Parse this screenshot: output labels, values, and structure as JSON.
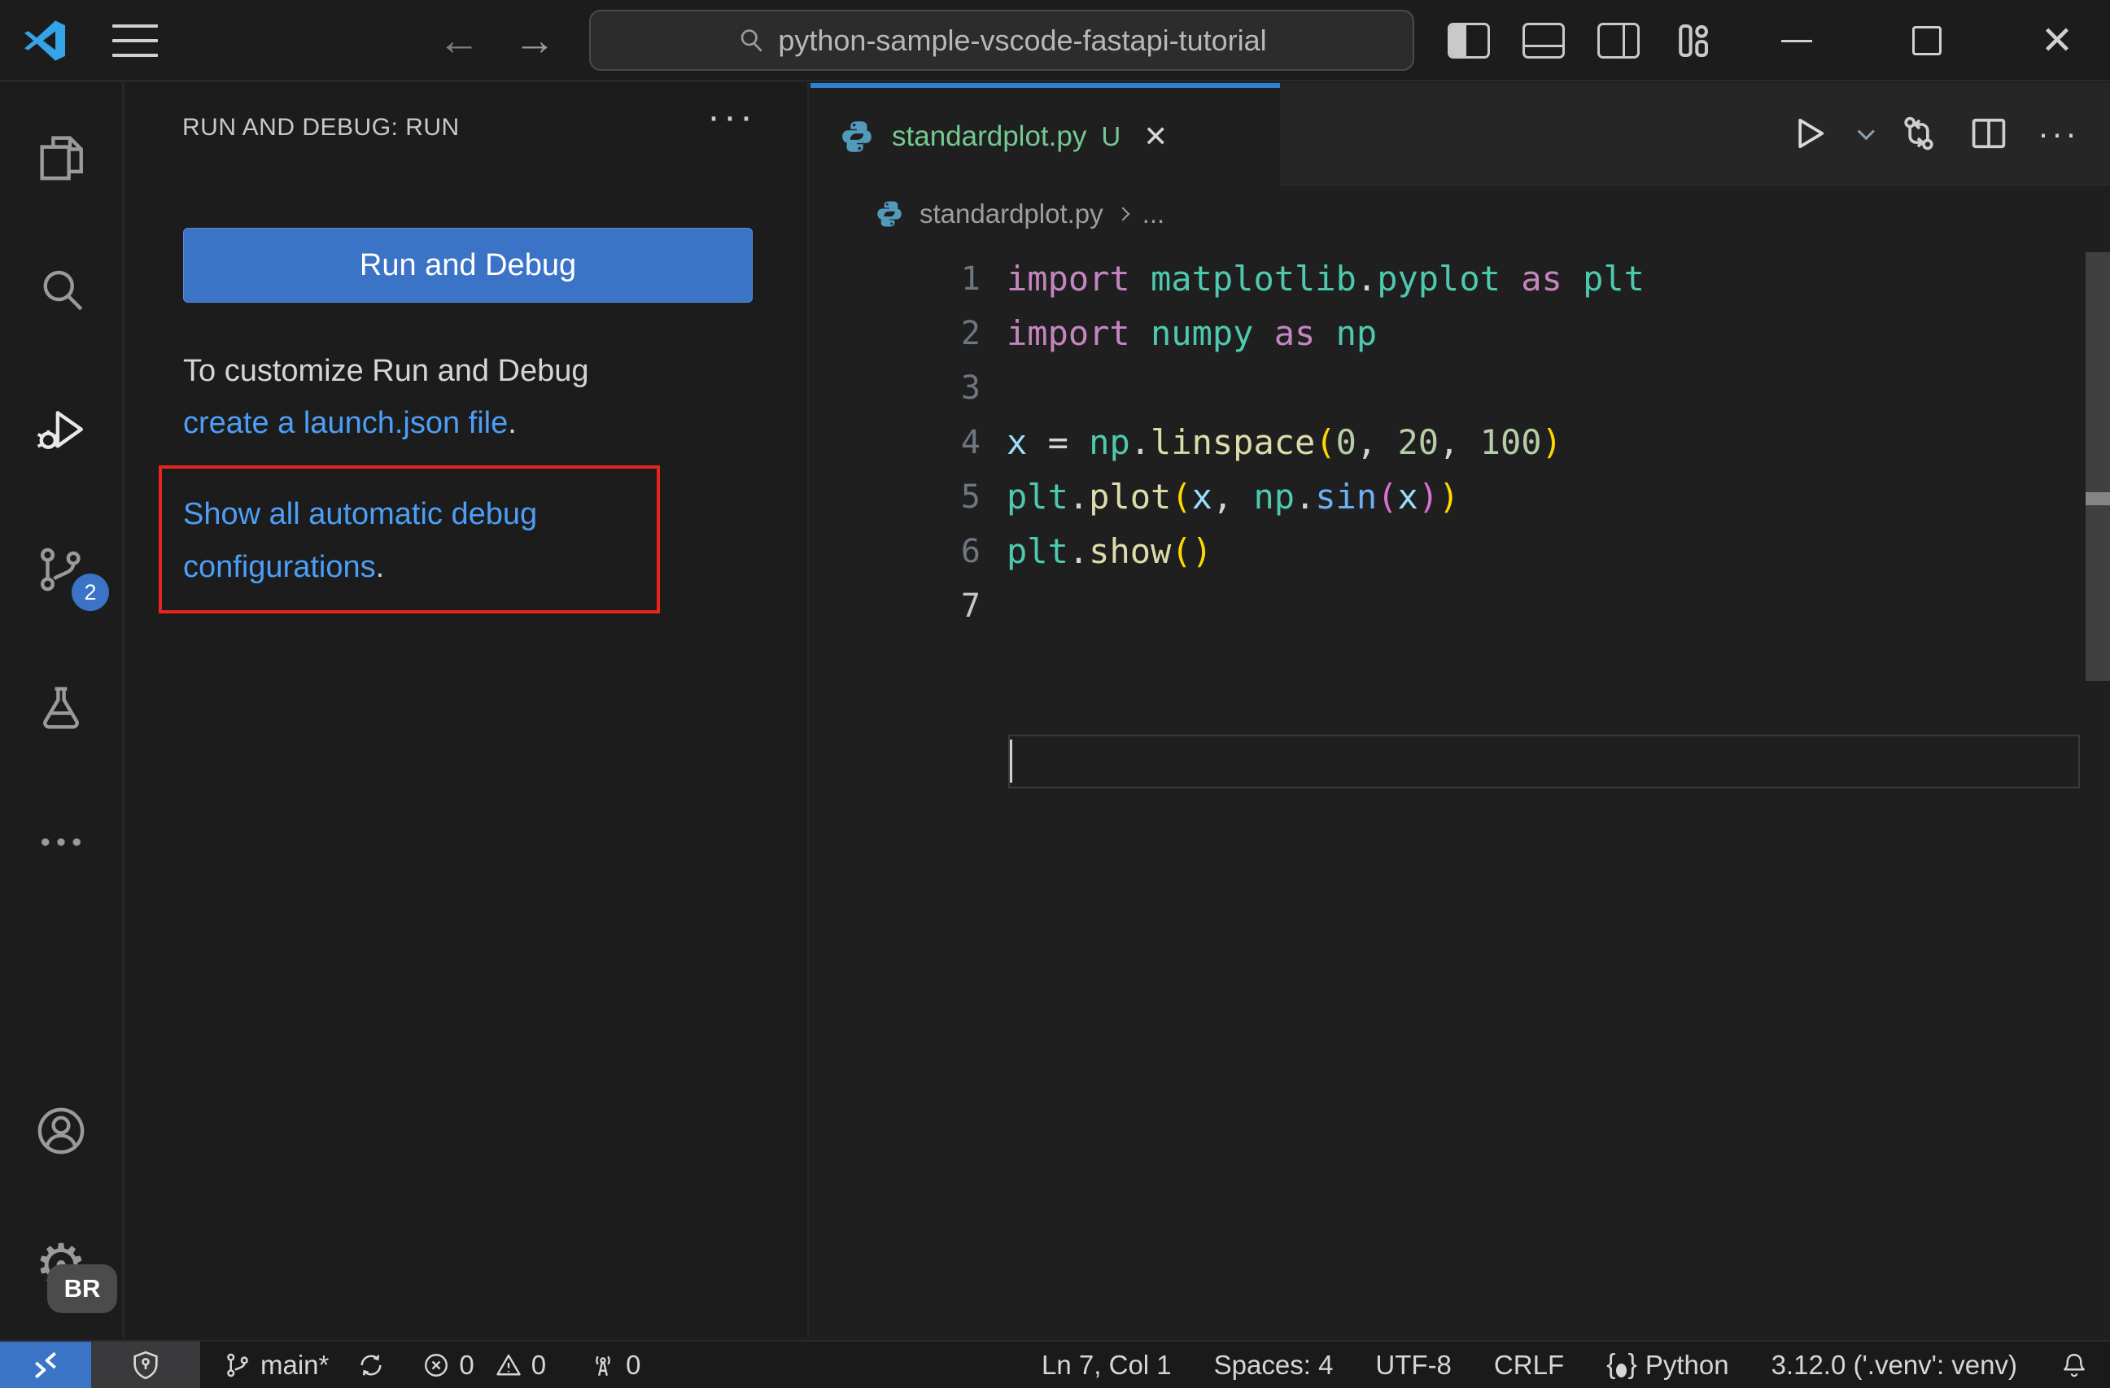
{
  "titlebar": {
    "search_value": "python-sample-vscode-fastapi-tutorial"
  },
  "colors": {
    "accent_blue": "#3b73c6",
    "link_blue": "#4d9ef7",
    "annotation_red": "#e6261c",
    "file_green": "#73c991",
    "tab_border_blue": "#2f81d7",
    "tok_kw": "#c586c0",
    "tok_mod": "#4ec9b0",
    "tok_fn": "#dcdcaa",
    "tok_fnb": "#6cb0f3",
    "tok_var": "#9cdcfe",
    "tok_num": "#b5cea8",
    "tok_op": "#d4d4d4",
    "tok_b1": "#ffd700",
    "tok_b2": "#da70d6"
  },
  "activity_bar": {
    "scm_badge": "2",
    "profile_badge": "BR"
  },
  "sidebar": {
    "header": "RUN AND DEBUG: RUN",
    "menu_dots": "···",
    "run_button": "Run and Debug",
    "intro_line": "To customize Run and Debug",
    "launch_link": "create a launch.json file",
    "launch_suffix": ".",
    "auto_debug_link": "Show all automatic debug configurations",
    "auto_debug_suffix": "."
  },
  "editor": {
    "tab": {
      "label": "standardplot.py",
      "dirty": "U",
      "close": "✕"
    },
    "actions_dots": "···",
    "breadcrumb": {
      "file": "standardplot.py",
      "more": "..."
    },
    "code": {
      "lines": [
        {
          "num": "1",
          "tokens": [
            {
              "c": "kw",
              "t": "import "
            },
            {
              "c": "mod",
              "t": "matplotlib"
            },
            {
              "c": "op",
              "t": "."
            },
            {
              "c": "mod",
              "t": "pyplot"
            },
            {
              "c": "kw",
              "t": " as "
            },
            {
              "c": "mod",
              "t": "plt"
            }
          ]
        },
        {
          "num": "2",
          "tokens": [
            {
              "c": "kw",
              "t": "import "
            },
            {
              "c": "mod",
              "t": "numpy"
            },
            {
              "c": "kw",
              "t": " as "
            },
            {
              "c": "mod",
              "t": "np"
            }
          ]
        },
        {
          "num": "3",
          "tokens": []
        },
        {
          "num": "4",
          "tokens": [
            {
              "c": "var",
              "t": "x"
            },
            {
              "c": "op",
              "t": " = "
            },
            {
              "c": "mod",
              "t": "np"
            },
            {
              "c": "op",
              "t": "."
            },
            {
              "c": "fn",
              "t": "linspace"
            },
            {
              "c": "b1",
              "t": "("
            },
            {
              "c": "num",
              "t": "0"
            },
            {
              "c": "op",
              "t": ", "
            },
            {
              "c": "num",
              "t": "20"
            },
            {
              "c": "op",
              "t": ", "
            },
            {
              "c": "num",
              "t": "100"
            },
            {
              "c": "b1",
              "t": ")"
            }
          ]
        },
        {
          "num": "5",
          "tokens": [
            {
              "c": "mod",
              "t": "plt"
            },
            {
              "c": "op",
              "t": "."
            },
            {
              "c": "fn",
              "t": "plot"
            },
            {
              "c": "b1",
              "t": "("
            },
            {
              "c": "var",
              "t": "x"
            },
            {
              "c": "op",
              "t": ", "
            },
            {
              "c": "mod",
              "t": "np"
            },
            {
              "c": "op",
              "t": "."
            },
            {
              "c": "fnb",
              "t": "sin"
            },
            {
              "c": "b2",
              "t": "("
            },
            {
              "c": "var",
              "t": "x"
            },
            {
              "c": "b2",
              "t": ")"
            },
            {
              "c": "b1",
              "t": ")"
            }
          ]
        },
        {
          "num": "6",
          "tokens": [
            {
              "c": "mod",
              "t": "plt"
            },
            {
              "c": "op",
              "t": "."
            },
            {
              "c": "fn",
              "t": "show"
            },
            {
              "c": "b1",
              "t": "("
            },
            {
              "c": "b1",
              "t": ")"
            }
          ]
        },
        {
          "num": "7",
          "tokens": []
        }
      ]
    }
  },
  "status_bar": {
    "branch": "main*",
    "errors": "0",
    "warnings": "0",
    "ports": "0",
    "cursor_position": "Ln 7, Col 1",
    "indentation": "Spaces: 4",
    "encoding": "UTF-8",
    "eol": "CRLF",
    "language": "Python",
    "interpreter": "3.12.0 ('.venv': venv)"
  }
}
